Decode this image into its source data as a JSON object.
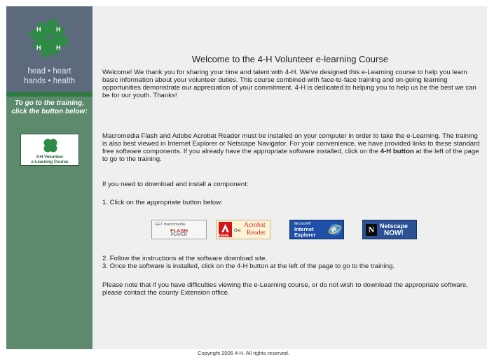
{
  "sidebar": {
    "motto_line1": "head • heart",
    "motto_line2": "hands • health",
    "instructions": "To go to the training, click the button below:",
    "course_button": {
      "line1": "4-H Volunteer",
      "line2": "e-Learning Course",
      "icon": "four-leaf-clover-icon"
    },
    "colors": {
      "sidebar": "#5d8a6c",
      "logo_bg": "#5d6a7d",
      "clover": "#2f8a45"
    }
  },
  "main": {
    "title": "Welcome to the 4-H Volunteer e-learning Course",
    "paragraph1": "Welcome! We thank you for sharing your time and talent with 4-H. We've designed this e-Learning course to help you learn basic information about your volunteer duties. This course combined with face-to-face training and on-going learning opportunities demonstrate our appreciation of your commitment. 4-H is dedicated to helping you to help us be the best we can be for our youth. Thanks!",
    "paragraph2_before": "Macromedia Flash and Adobe Acrobat Reader must be installed on your computer in order to take the e-Learning. The training is also best viewed in Internet Explorer or Netscape Navigator. For your convenience, we have provided links to these standard free software components. If you already have the appropriate software installed, click on the ",
    "paragraph2_bold": "4-H button",
    "paragraph2_after": " at the left of the page to go to the training.",
    "paragraph3": "If you need to download and install a component:",
    "step1": "1. Click on the appropriate button below:",
    "step2": "2. Follow the instructions at the software download site.",
    "step3": "3. Once the software is installed, click on the 4-H button at the left of the page to go to the training.",
    "note": "Please note that if you have difficulties viewing the e-Learning course, or do not wish to download the appropriate software, please contact the county Extension office."
  },
  "downloads": {
    "flash": {
      "line1": "GET macromedia",
      "line2": "FLASH",
      "line3": "PLAYER"
    },
    "acrobat": {
      "adobe": "Adobe",
      "get": "Get",
      "line1": "Acrobat",
      "line2": "Reader"
    },
    "ie": {
      "ms": "Microsoft®",
      "line1": "Internet",
      "line2": "Explorer"
    },
    "netscape": {
      "icon": "N",
      "line1": "Netscape",
      "line2": "NOW!"
    }
  },
  "footer": {
    "copyright": "Copyright 2006 4-H. All rights reserved."
  }
}
